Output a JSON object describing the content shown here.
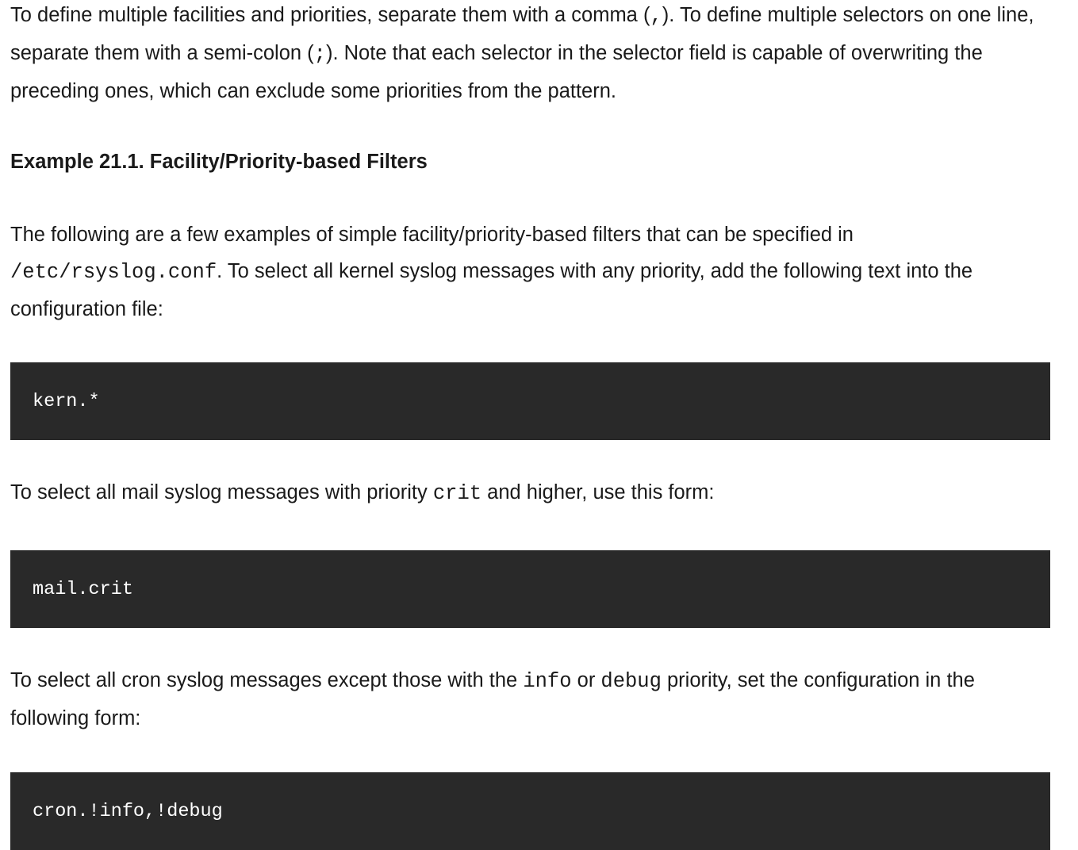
{
  "para_selectors": {
    "t1": "To define multiple facilities and priorities, separate them with a comma (",
    "c1": ",",
    "t2": "). To define multiple selectors on one line, separate them with a semi-colon (",
    "c2": ";",
    "t3": "). Note that each selector in the selector field is capable of overwriting the preceding ones, which can exclude some priorities from the pattern."
  },
  "example_title": "Example 21.1. Facility/Priority-based Filters",
  "para_intro": {
    "t1": "The following are a few examples of simple facility/priority-based filters that can be specified in ",
    "c1": "/etc/rsyslog.conf",
    "t2": ". To select all kernel syslog messages with any priority, add the following text into the configuration file:"
  },
  "code_kern": "kern.*",
  "para_mail": {
    "t1": "To select all mail syslog messages with priority ",
    "c1": "crit",
    "t2": " and higher, use this form:"
  },
  "code_mail": "mail.crit",
  "para_cron": {
    "t1": "To select all cron syslog messages except those with the ",
    "c1": "info",
    "t2": " or ",
    "c2": "debug",
    "t3": " priority, set the configuration in the following form:"
  },
  "code_cron": "cron.!info,!debug"
}
